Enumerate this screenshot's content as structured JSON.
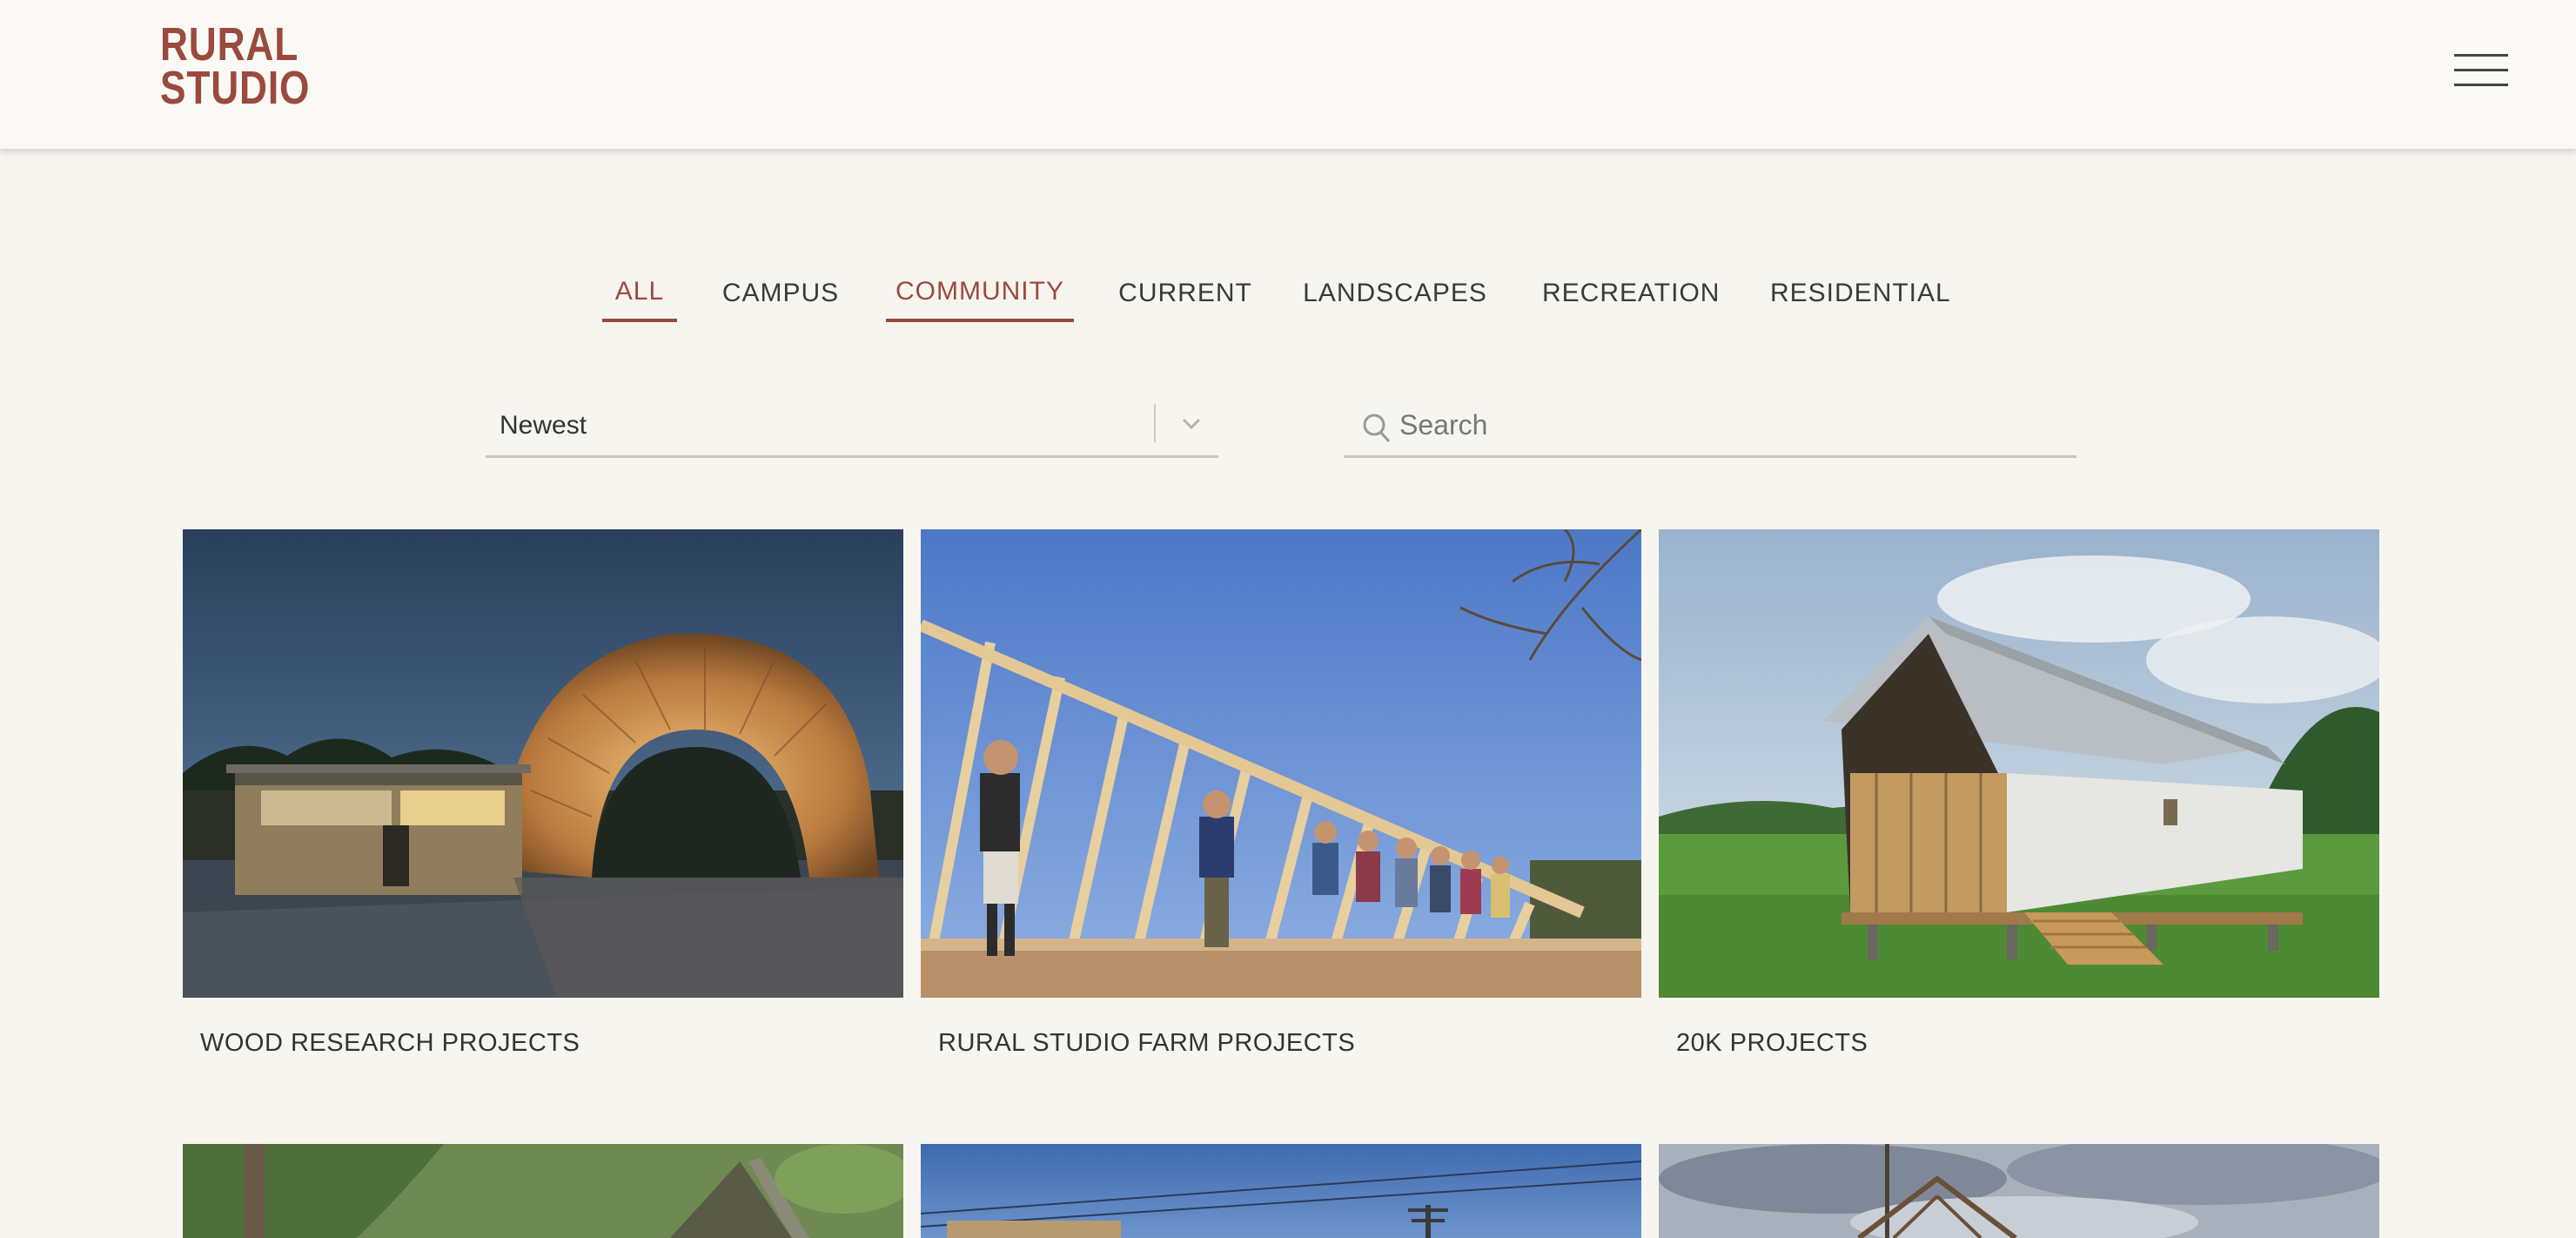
{
  "brand": {
    "line1": "RURAL",
    "line2": "STUDIO",
    "color": "#9b4a3e"
  },
  "header": {
    "menu_icon": "hamburger-icon"
  },
  "filters": {
    "tabs": [
      {
        "label": "ALL",
        "active": true
      },
      {
        "label": "CAMPUS",
        "active": false
      },
      {
        "label": "COMMUNITY",
        "active": true
      },
      {
        "label": "CURRENT",
        "active": false
      },
      {
        "label": "LANDSCAPES",
        "active": false
      },
      {
        "label": "RECREATION",
        "active": false
      },
      {
        "label": "RESIDENTIAL",
        "active": false
      }
    ]
  },
  "sort": {
    "value": "Newest",
    "icon": "chevron-down-icon"
  },
  "search": {
    "placeholder": "Search",
    "value": "",
    "icon": "search-icon"
  },
  "projects": [
    {
      "title": "WOOD RESEARCH PROJECTS"
    },
    {
      "title": "RURAL STUDIO FARM PROJECTS"
    },
    {
      "title": "20K PROJECTS"
    }
  ],
  "colors": {
    "accent": "#9b4a3e",
    "background": "#f7f5f0"
  }
}
